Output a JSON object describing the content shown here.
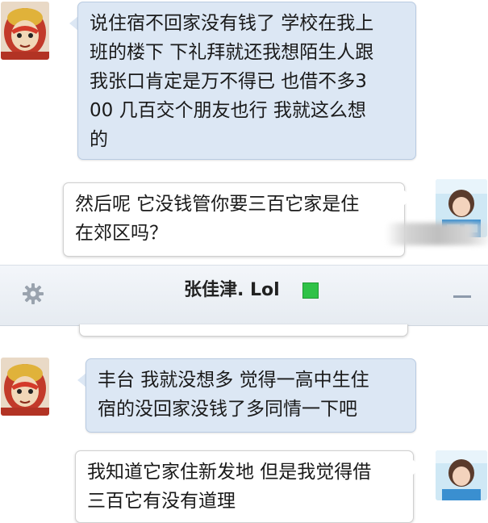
{
  "chat": {
    "title": "张佳津. Lol",
    "status_color": "#2fc247",
    "settings_icon": "gear-icon",
    "minimize_icon": "minimize-icon",
    "messages": [
      {
        "side": "in",
        "text": "说住宿不回家没有钱了 学校在我上\n班的楼下 下礼拜就还我想陌生人跟\n我张口肯定是万不得已 也借不多3\n00 几百交个朋友也行 我就这么想\n的"
      },
      {
        "side": "out",
        "text": "然后呢 它没钱管你要三百它家是住\n在郊区吗？"
      },
      {
        "side": "in",
        "text": "丰台 我就没想多 觉得一高中生住\n宿的没回家没钱了多同情一下吧"
      },
      {
        "side": "out",
        "text": "我知道它家住新发地 但是我觉得借\n三百它有没有道理"
      }
    ]
  }
}
